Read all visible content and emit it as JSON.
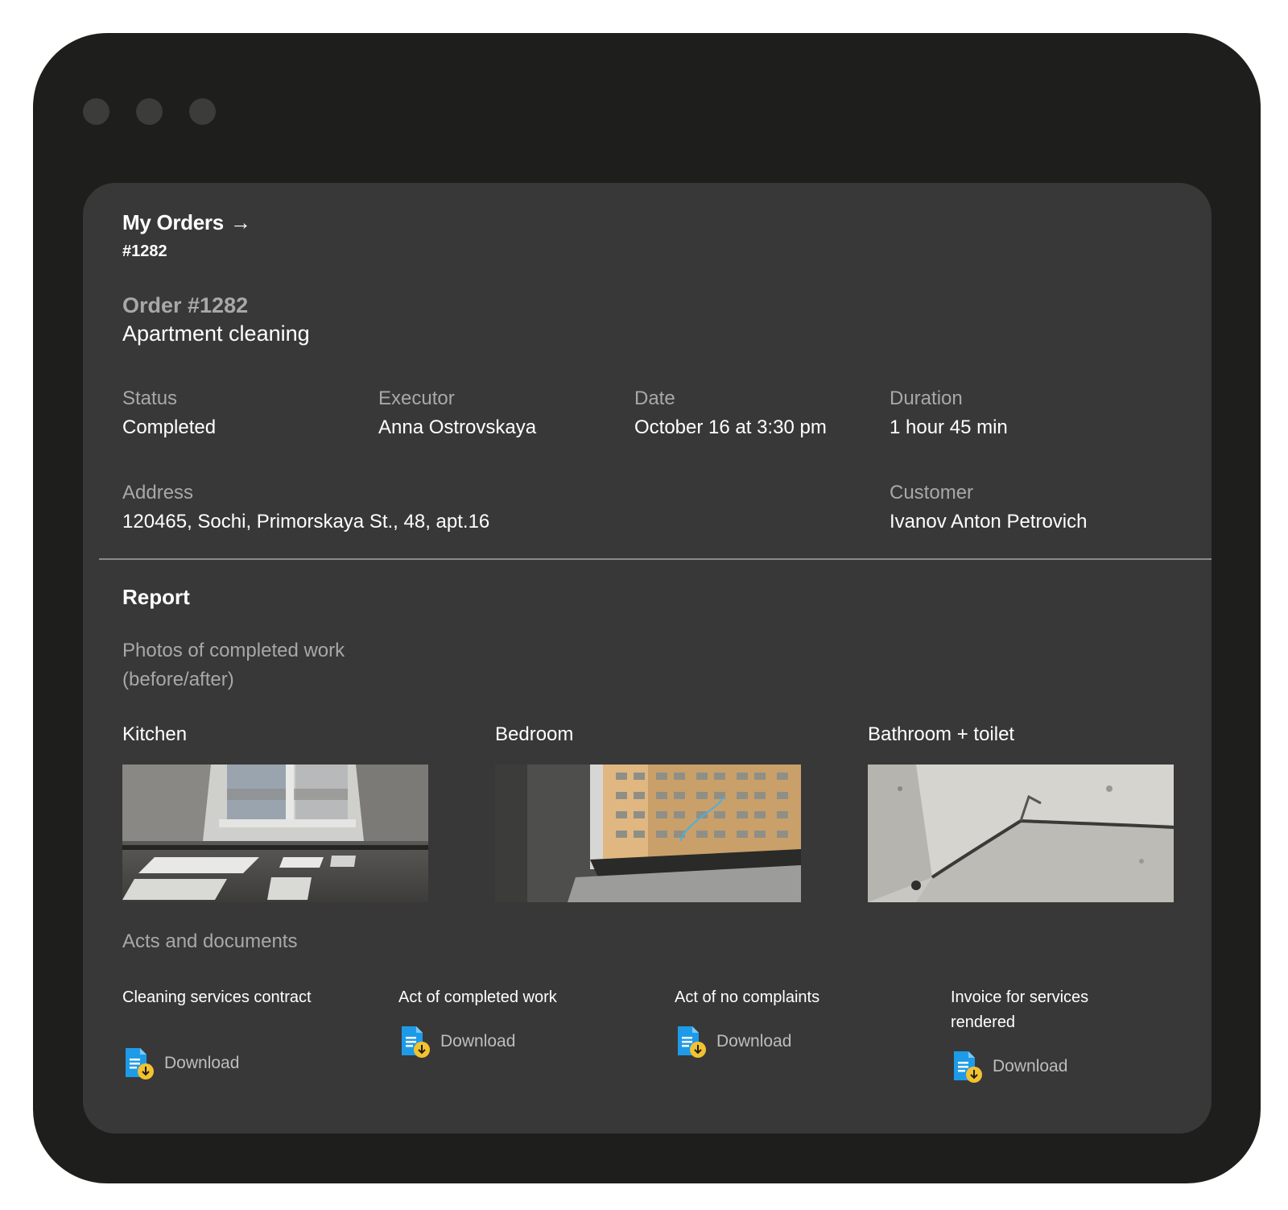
{
  "breadcrumb": {
    "parent": "My Orders",
    "arrow": "→",
    "current": "#1282"
  },
  "order": {
    "number": "Order #1282",
    "title": "Apartment cleaning"
  },
  "details": {
    "status": {
      "label": "Status",
      "value": "Completed"
    },
    "executor": {
      "label": "Executor",
      "value": "Anna Ostrovskaya"
    },
    "date": {
      "label": "Date",
      "value": "October 16 at 3:30 pm"
    },
    "duration": {
      "label": "Duration",
      "value": "1 hour 45 min"
    },
    "address": {
      "label": "Address",
      "value": "120465, Sochi, Primorskaya St., 48, apt.16"
    },
    "customer": {
      "label": "Customer",
      "value": "Ivanov Anton Petrovich"
    }
  },
  "report": {
    "title": "Report",
    "photos_label": "Photos of completed work (before/after)",
    "photos": [
      {
        "room": "Kitchen"
      },
      {
        "room": "Bedroom"
      },
      {
        "room": "Bathroom + toilet"
      }
    ],
    "acts_label": "Acts and documents",
    "documents": [
      {
        "title": "Cleaning services contract",
        "action": "Download"
      },
      {
        "title": "Act of completed work",
        "action": "Download"
      },
      {
        "title": "Act of no complaints",
        "action": "Download"
      },
      {
        "title": "Invoice for services rendered",
        "action": "Download"
      }
    ]
  },
  "colors": {
    "window": "#1e1e1c",
    "card": "#383838",
    "muted": "#a8a8a8",
    "doc_icon": "#1e9be8",
    "doc_badge": "#f2c230"
  },
  "icons": {
    "document": "document-download-icon"
  }
}
